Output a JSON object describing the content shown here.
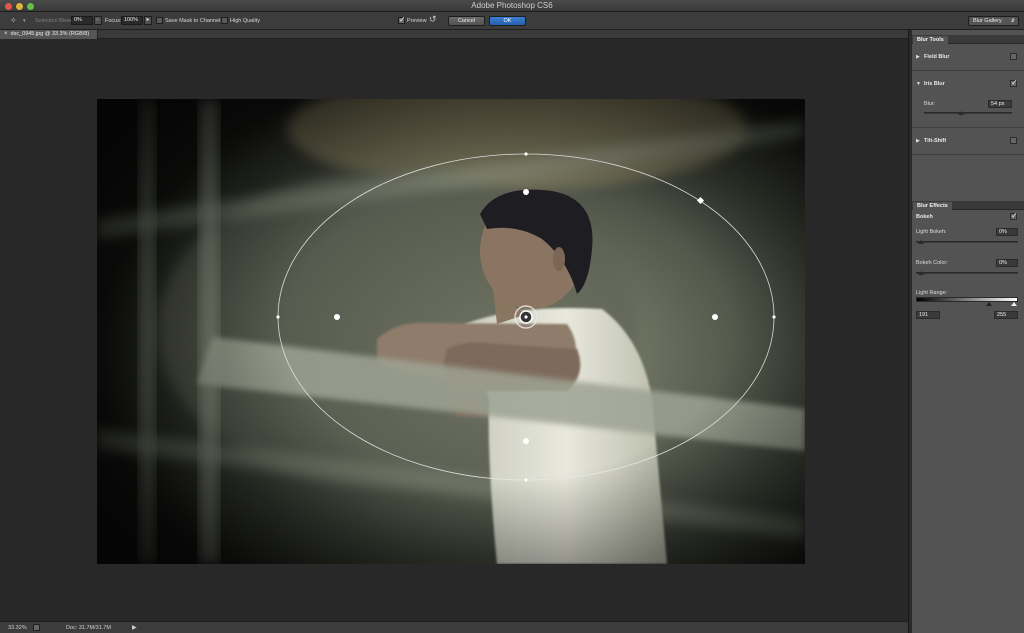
{
  "window": {
    "title": "Adobe Photoshop CS6"
  },
  "options_bar": {
    "selection_bleed_label": "Selection Bleed:",
    "selection_bleed_value": "0%",
    "focus_label": "Focus:",
    "focus_value": "100%",
    "save_mask_label": "Save Mask to Channels",
    "high_quality_label": "High Quality",
    "preview_label": "Preview",
    "cancel_label": "Cancel",
    "ok_label": "OK",
    "workspace_label": "Blur Gallery"
  },
  "document": {
    "tab_label": "dsc_0945.jpg @ 33.3% (RGB/8)"
  },
  "status_bar": {
    "zoom": "33.32%",
    "doc_info": "Doc: 31.7M/31.7M"
  },
  "blur_tools": {
    "tab_label": "Blur Tools",
    "field_blur_label": "Field Blur",
    "iris_blur_label": "Iris Blur",
    "blur_label": "Blur:",
    "blur_value": "54 px",
    "tilt_shift_label": "Tilt-Shift"
  },
  "blur_effects": {
    "tab_label": "Blur Effects",
    "bokeh_label": "Bokeh",
    "light_bokeh_label": "Light Bokeh:",
    "light_bokeh_value": "0%",
    "bokeh_color_label": "Bokeh Color:",
    "bokeh_color_value": "0%",
    "light_range_label": "Light Range:",
    "light_range_low": "191",
    "light_range_high": "255"
  }
}
